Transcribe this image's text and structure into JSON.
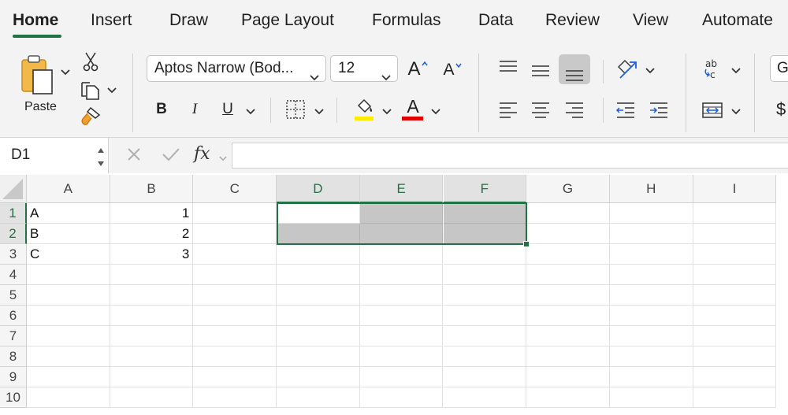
{
  "tabs": [
    "Home",
    "Insert",
    "Draw",
    "Page Layout",
    "Formulas",
    "Data",
    "Review",
    "View",
    "Automate"
  ],
  "ribbon": {
    "paste_label": "Paste",
    "font_name": "Aptos Narrow (Bod...",
    "font_size": "12",
    "increase_font_glyph": "A",
    "decrease_font_glyph": "A",
    "bold_glyph": "B",
    "italic_glyph": "I",
    "underline_glyph": "U",
    "font_color_glyph": "A",
    "number_format_partial": "G",
    "currency_partial": "$",
    "highlight_color": "#ffeb00",
    "font_color": "#e00000",
    "accent": "#217346"
  },
  "formula_bar": {
    "name_box": "D1",
    "fx_label": "fx",
    "formula": ""
  },
  "grid": {
    "columns": [
      "A",
      "B",
      "C",
      "D",
      "E",
      "F",
      "G",
      "H",
      "I"
    ],
    "rows": [
      "1",
      "2",
      "3",
      "4",
      "5",
      "6",
      "7",
      "8",
      "9",
      "10"
    ],
    "cells": {
      "A1": "A",
      "B1": "1",
      "A2": "B",
      "B2": "2",
      "A3": "C",
      "B3": "3"
    },
    "selected_range": "D1:F2",
    "active_cell": "D1"
  },
  "icons": [
    "clipboard-icon",
    "scissors-icon",
    "copy-icon",
    "format-painter-icon",
    "borders-icon",
    "fill-color-icon",
    "align-top-icon",
    "align-middle-icon",
    "align-bottom-icon",
    "orientation-icon",
    "wrap-text-icon",
    "align-left-icon",
    "align-center-icon",
    "align-right-icon",
    "decrease-indent-icon",
    "increase-indent-icon",
    "merge-center-icon",
    "cancel-icon",
    "enter-icon"
  ]
}
